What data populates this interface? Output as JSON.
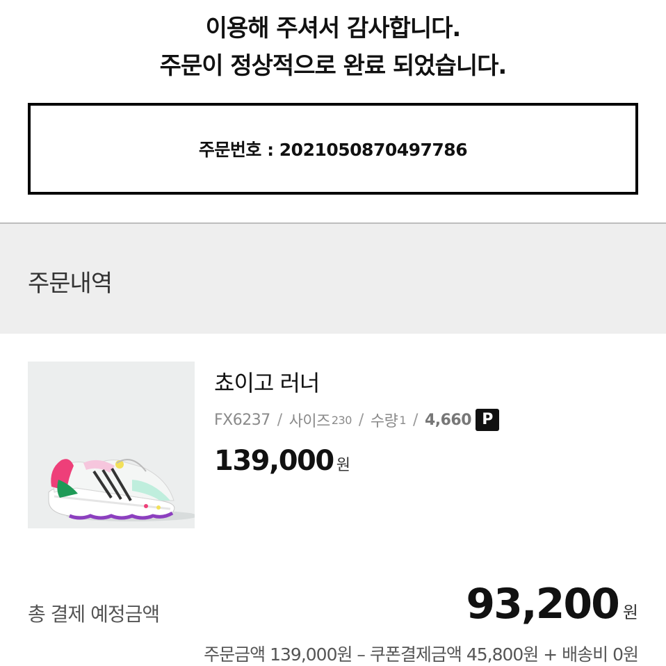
{
  "header": {
    "line1": "이용해 주셔서 감사합니다.",
    "line2": "주문이 정상적으로 완료 되었습니다."
  },
  "order": {
    "number_text": "주문번호 : 2021050870497786"
  },
  "section": {
    "title": "주문내역"
  },
  "item": {
    "name": "쵸이고 러너",
    "code": "FX6237",
    "size_label": "사이즈",
    "size": "230",
    "qty_label": "수량",
    "qty": "1",
    "points": "4,660",
    "points_badge": "P",
    "price": "139,000",
    "currency": "원"
  },
  "summary": {
    "label": "총 결제 예정금액",
    "total": "93,200",
    "currency": "원",
    "breakdown": "주문금액 139,000원 – 쿠폰결제금액 45,800원 + 배송비 0원"
  },
  "colors": {
    "accent": "#111111",
    "section_bg": "#eeeeee",
    "muted": "#8a8a8a"
  },
  "icons": {
    "points_badge": "points-badge-icon",
    "product": "sneaker-image"
  }
}
